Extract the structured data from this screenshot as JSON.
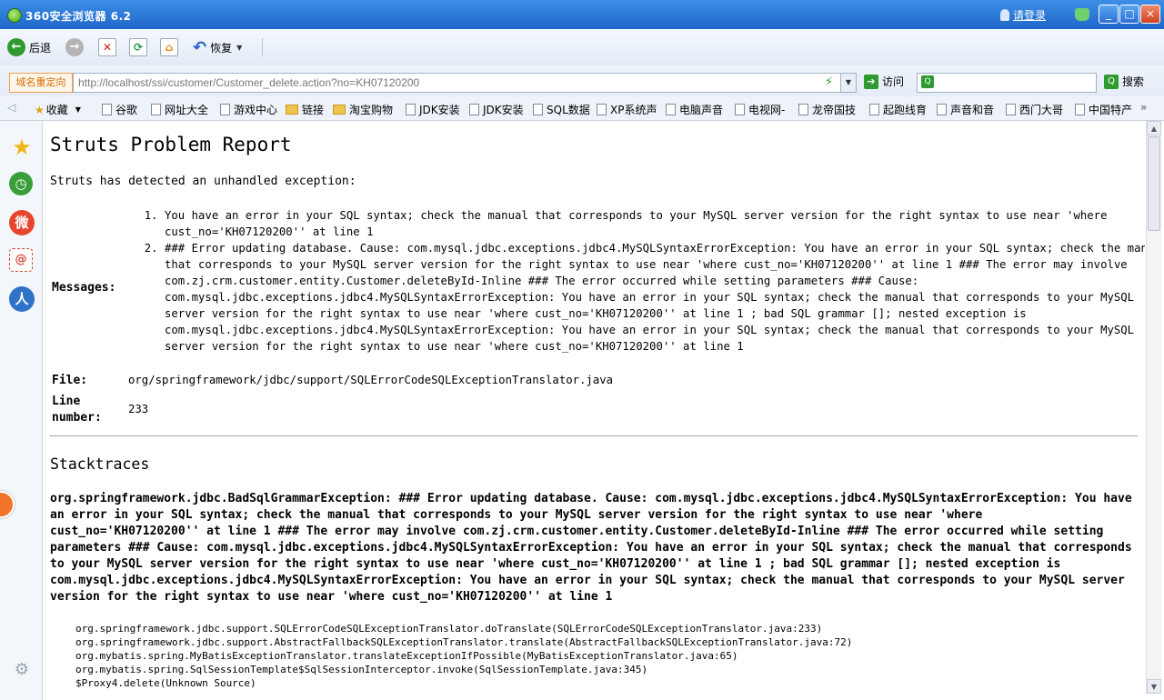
{
  "window": {
    "title": "360安全浏览器 6.2",
    "login_label": "请登录",
    "minimize": "_",
    "maximize": "□",
    "close": "×"
  },
  "toolbar": {
    "back_label": "后退",
    "forward_icon": "→",
    "undo_label": "恢复"
  },
  "address": {
    "redirect_label": "域名重定向",
    "url": "http://localhost/ssi/customer/Customer_delete.action?no=KH07120200",
    "visit_label": "访问",
    "search_placeholder": "",
    "search_label": "搜索"
  },
  "favorites": {
    "label": "收藏",
    "items": [
      "谷歌",
      "网址大全",
      "游戏中心",
      "链接",
      "淘宝购物",
      "JDK安装",
      "JDK安装",
      "SQL数据",
      "XP系统声",
      "电脑声音",
      "电视网-",
      "龙帝国技",
      "起跑线育",
      "声音和音",
      "西门大哥",
      "中国特产"
    ],
    "more": "»"
  },
  "page": {
    "title": "Struts Problem Report",
    "intro": "Struts has detected an unhandled exception:",
    "messages_label": "Messages:",
    "messages": [
      "You have an error in your SQL syntax; check the manual that corresponds to your MySQL server version for the right syntax to use near 'where cust_no='KH07120200'' at line 1",
      "### Error updating database. Cause: com.mysql.jdbc.exceptions.jdbc4.MySQLSyntaxErrorException: You have an error in your SQL syntax; check the manual that corresponds to your MySQL server version for the right syntax to use near 'where cust_no='KH07120200'' at line 1 ### The error may involve com.zj.crm.customer.entity.Customer.deleteById-Inline ### The error occurred while setting parameters ### Cause: com.mysql.jdbc.exceptions.jdbc4.MySQLSyntaxErrorException: You have an error in your SQL syntax; check the manual that corresponds to your MySQL server version for the right syntax to use near 'where cust_no='KH07120200'' at line 1 ; bad SQL grammar []; nested exception is com.mysql.jdbc.exceptions.jdbc4.MySQLSyntaxErrorException: You have an error in your SQL syntax; check the manual that corresponds to your MySQL server version for the right syntax to use near 'where cust_no='KH07120200'' at line 1"
    ],
    "file_label": "File:",
    "file": "org/springframework/jdbc/support/SQLErrorCodeSQLExceptionTranslator.java",
    "line_label": "Line number:",
    "line": "233",
    "stacktraces_title": "Stacktraces",
    "exception": "org.springframework.jdbc.BadSqlGrammarException: ### Error updating database. Cause: com.mysql.jdbc.exceptions.jdbc4.MySQLSyntaxErrorException: You have an error in your SQL syntax; check the manual that corresponds to your MySQL server version for the right syntax to use near 'where cust_no='KH07120200'' at line 1 ### The error may involve com.zj.crm.customer.entity.Customer.deleteById-Inline ### The error occurred while setting parameters ### Cause: com.mysql.jdbc.exceptions.jdbc4.MySQLSyntaxErrorException: You have an error in your SQL syntax; check the manual that corresponds to your MySQL server version for the right syntax to use near 'where cust_no='KH07120200'' at line 1 ; bad SQL grammar []; nested exception is com.mysql.jdbc.exceptions.jdbc4.MySQLSyntaxErrorException: You have an error in your SQL syntax; check the manual that corresponds to your MySQL server version for the right syntax to use near 'where cust_no='KH07120200'' at line 1",
    "frames": [
      "org.springframework.jdbc.support.SQLErrorCodeSQLExceptionTranslator.doTranslate(SQLErrorCodeSQLExceptionTranslator.java:233)",
      "org.springframework.jdbc.support.AbstractFallbackSQLExceptionTranslator.translate(AbstractFallbackSQLExceptionTranslator.java:72)",
      "org.mybatis.spring.MyBatisExceptionTranslator.translateExceptionIfPossible(MyBatisExceptionTranslator.java:65)",
      "org.mybatis.spring.SqlSessionTemplate$SqlSessionInterceptor.invoke(SqlSessionTemplate.java:345)",
      "$Proxy4.delete(Unknown Source)"
    ]
  },
  "icons": {
    "sidebar": [
      "favorites-star-icon",
      "history-clock-icon",
      "weibo-icon",
      "mail-icon",
      "chat-icon",
      "settings-gear-icon"
    ]
  }
}
